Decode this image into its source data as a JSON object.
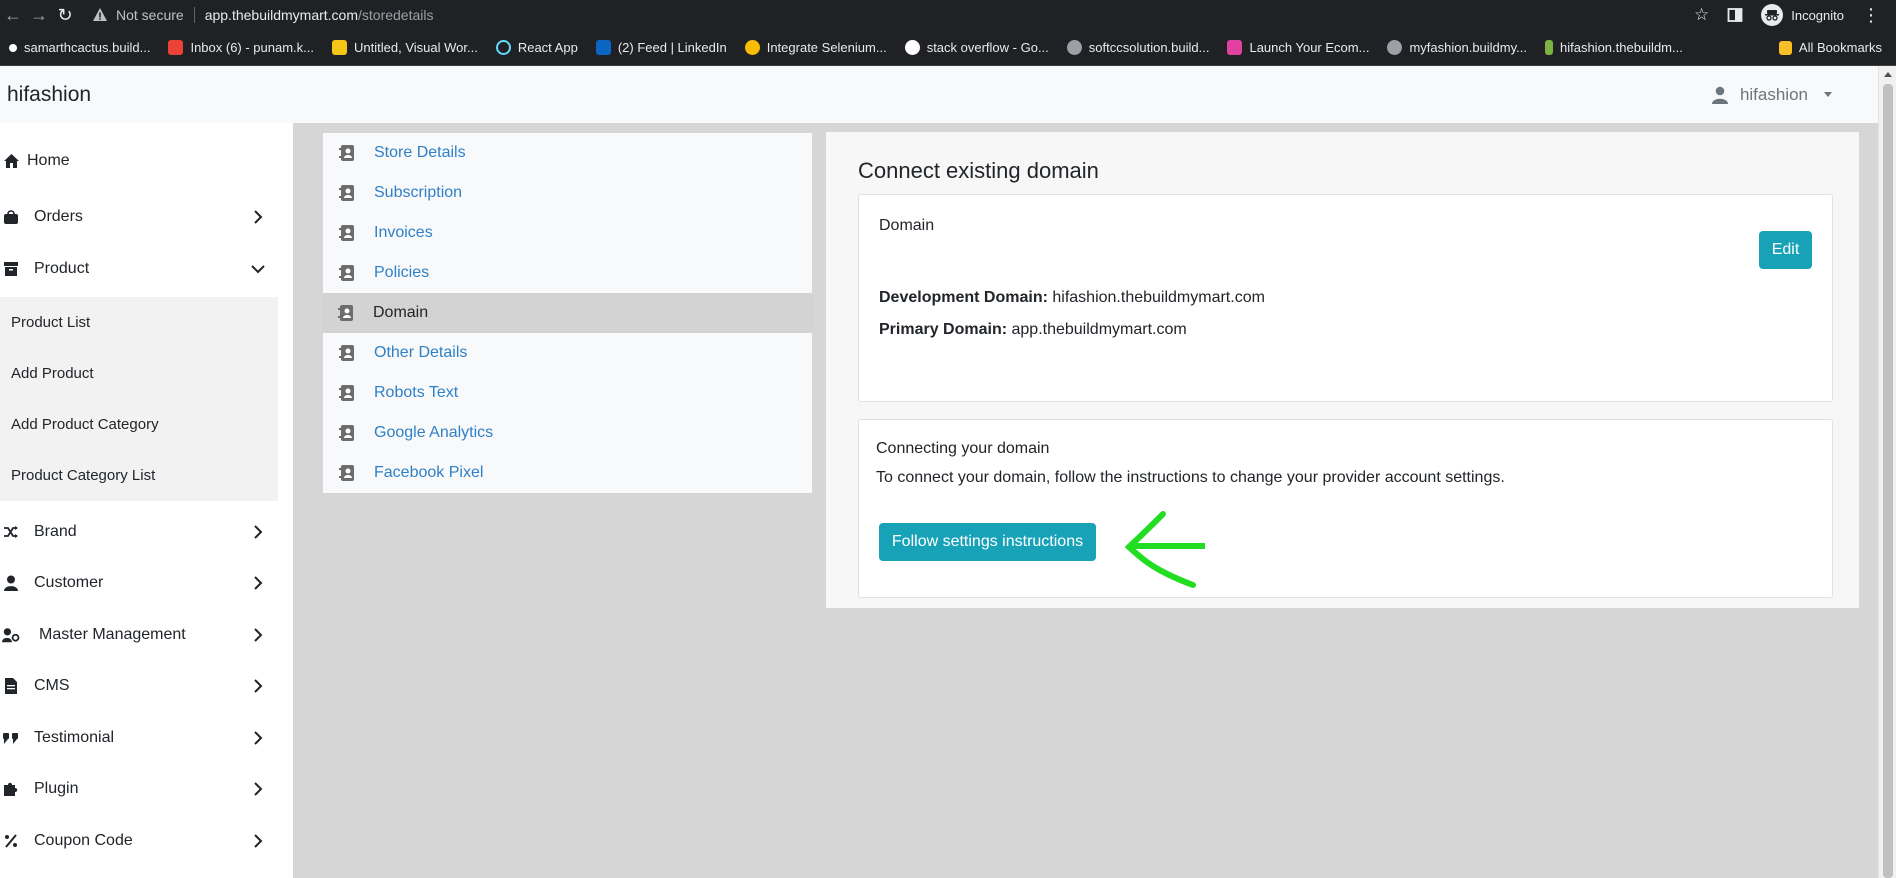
{
  "browser": {
    "not_secure": "Not secure",
    "url_host": "app.thebuildmymart.com",
    "url_path": "/storedetails",
    "incognito": "Incognito",
    "bookmarks": [
      {
        "label": "samarthcactus.build...",
        "color": "#ffffff"
      },
      {
        "label": "Inbox (6) - punam.k...",
        "color": "#ea4335"
      },
      {
        "label": "Untitled, Visual Wor...",
        "color": "#f5c518"
      },
      {
        "label": "React App",
        "color": "#61dafb"
      },
      {
        "label": "(2) Feed | LinkedIn",
        "color": "#0a66c2"
      },
      {
        "label": "Integrate Selenium...",
        "color": "#fbbc04"
      },
      {
        "label": "stack overflow - Go...",
        "color": "#ffffff"
      },
      {
        "label": "softccsolution.build...",
        "color": "#9aa0a6"
      },
      {
        "label": "Launch Your Ecom...",
        "color": "#e040a0"
      },
      {
        "label": "myfashion.buildmy...",
        "color": "#9aa0a6"
      },
      {
        "label": "hifashion.thebuildm...",
        "color": "#7cb342"
      }
    ],
    "all_bookmarks": "All Bookmarks"
  },
  "header": {
    "brand": "hifashion",
    "user": "hifashion"
  },
  "sidebar": {
    "items": [
      {
        "label": "Home",
        "icon": "home-icon"
      },
      {
        "label": "Orders",
        "icon": "bag-icon"
      },
      {
        "label": "Product",
        "icon": "archive-icon"
      },
      {
        "label": "Brand",
        "icon": "shuffle-icon"
      },
      {
        "label": "Customer",
        "icon": "user-icon"
      },
      {
        "label": "Master Management",
        "icon": "user-cog-icon"
      },
      {
        "label": "CMS",
        "icon": "file-icon"
      },
      {
        "label": "Testimonial",
        "icon": "quote-icon"
      },
      {
        "label": "Plugin",
        "icon": "puzzle-icon"
      },
      {
        "label": "Coupon Code",
        "icon": "percent-icon"
      }
    ],
    "product_sub": [
      "Product List",
      "Add Product",
      "Add Product Category",
      "Product Category List"
    ]
  },
  "settings_menu": {
    "items": [
      "Store Details",
      "Subscription",
      "Invoices",
      "Policies",
      "Domain",
      "Other Details",
      "Robots Text",
      "Google Analytics",
      "Facebook Pixel"
    ],
    "active_index": 4
  },
  "main": {
    "title": "Connect existing domain",
    "domain_card": {
      "heading": "Domain",
      "edit_label": "Edit",
      "dev_label": "Development Domain:",
      "dev_value": "hifashion.thebuildmymart.com",
      "primary_label": "Primary Domain:",
      "primary_value": "app.thebuildmymart.com"
    },
    "connect_card": {
      "heading": "Connecting your domain",
      "text": "To connect your domain, follow the instructions to change your provider account settings.",
      "button": "Follow settings instructions"
    }
  },
  "colors": {
    "accent": "#17a2b8",
    "link": "#2f80c7",
    "annotation": "#22dd22"
  }
}
